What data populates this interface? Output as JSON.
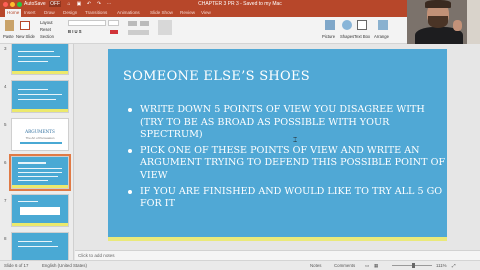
{
  "window": {
    "autosave": "AutoSave",
    "autosave_state": "OFF",
    "doc_title": "CHAPTER 3  PR 3 - Saved to my Mac"
  },
  "ribbon_tabs": [
    "Home",
    "Insert",
    "Draw",
    "Design",
    "Transitions",
    "Animations",
    "Slide Show",
    "Review",
    "View"
  ],
  "ribbon": {
    "paste": "Paste",
    "new_slide": "New Slide",
    "layout": "Layout",
    "reset": "Reset",
    "section": "Section",
    "picture": "Picture",
    "shapes": "Shapes",
    "text_box": "Text Box",
    "arrange": "Arrange"
  },
  "thumbnails": [
    {
      "num": "3",
      "style": "blue",
      "selected": false
    },
    {
      "num": "4",
      "style": "blue",
      "selected": false
    },
    {
      "num": "5",
      "style": "white",
      "selected": false,
      "title": "ARGUMENTS",
      "subtitle": "The Art of Persuasion"
    },
    {
      "num": "6",
      "style": "blue",
      "selected": true
    },
    {
      "num": "7",
      "style": "blue",
      "selected": false
    },
    {
      "num": "8",
      "style": "blue",
      "selected": false
    }
  ],
  "slide": {
    "title": "SOMEONE ELSE’S SHOES",
    "bullets": [
      "WRITE DOWN 5 POINTS OF VIEW YOU DISAGREE WITH (TRY TO BE AS BROAD AS POSSIBLE WITH YOUR SPECTRUM)",
      "PICK ONE OF THESE POINTS OF VIEW AND WRITE AN ARGUMENT TRYING TO DEFEND THIS POSSIBLE POINT OF VIEW",
      "IF YOU ARE FINISHED AND WOULD LIKE TO TRY ALL 5 GO FOR IT"
    ]
  },
  "notes_placeholder": "Click to add notes",
  "status": {
    "slide_counter": "Slide 6 of 17",
    "language": "English (United States)",
    "notes": "Notes",
    "comments": "Comments",
    "zoom": "111%",
    "zoom_fraction": 0.55
  },
  "colors": {
    "accent": "#b7472a",
    "slide_bg": "#50a8d5",
    "slide_footer": "#eae97a"
  }
}
